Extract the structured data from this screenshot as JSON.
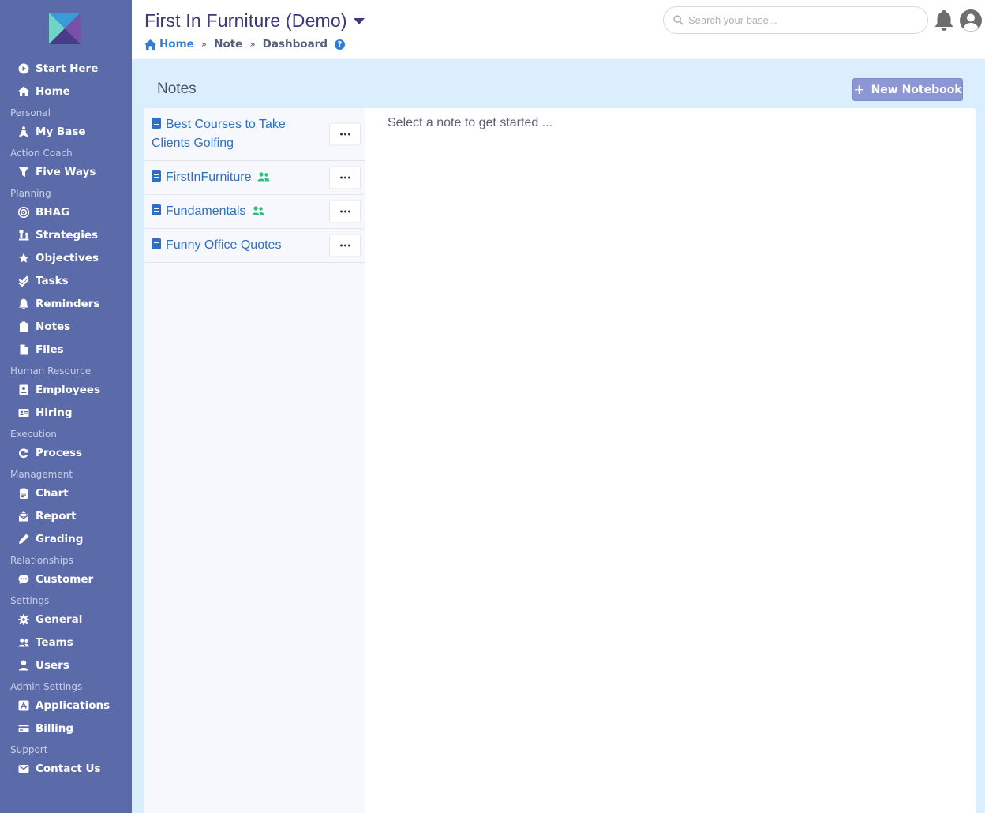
{
  "app": {
    "title": "First In Furniture (Demo)"
  },
  "breadcrumb": {
    "home": "Home",
    "items": [
      "Note",
      "Dashboard"
    ],
    "separator": "»",
    "help": "?"
  },
  "search": {
    "placeholder": "Search your base..."
  },
  "sidebar": {
    "items": [
      {
        "type": "item",
        "label": "Start Here",
        "icon": "play-circle-icon"
      },
      {
        "type": "item",
        "label": "Home",
        "icon": "home-icon"
      },
      {
        "type": "section",
        "label": "Personal"
      },
      {
        "type": "item",
        "label": "My Base",
        "icon": "meditation-icon"
      },
      {
        "type": "section",
        "label": "Action Coach"
      },
      {
        "type": "item",
        "label": "Five Ways",
        "icon": "five-ways-icon"
      },
      {
        "type": "section",
        "label": "Planning"
      },
      {
        "type": "item",
        "label": "BHAG",
        "icon": "target-icon"
      },
      {
        "type": "item",
        "label": "Strategies",
        "icon": "chess-icon"
      },
      {
        "type": "item",
        "label": "Objectives",
        "icon": "star-icon"
      },
      {
        "type": "item",
        "label": "Tasks",
        "icon": "check-double-icon"
      },
      {
        "type": "item",
        "label": "Reminders",
        "icon": "bell-icon"
      },
      {
        "type": "item",
        "label": "Notes",
        "icon": "clipboard-icon"
      },
      {
        "type": "item",
        "label": "Files",
        "icon": "file-icon"
      },
      {
        "type": "section",
        "label": "Human Resource"
      },
      {
        "type": "item",
        "label": "Employees",
        "icon": "contact-book-icon"
      },
      {
        "type": "item",
        "label": "Hiring",
        "icon": "id-card-icon"
      },
      {
        "type": "section",
        "label": "Execution"
      },
      {
        "type": "item",
        "label": "Process",
        "icon": "redo-icon"
      },
      {
        "type": "section",
        "label": "Management"
      },
      {
        "type": "item",
        "label": "Chart",
        "icon": "clipboard-list-icon"
      },
      {
        "type": "item",
        "label": "Report",
        "icon": "envelope-open-icon"
      },
      {
        "type": "item",
        "label": "Grading",
        "icon": "pen-icon"
      },
      {
        "type": "section",
        "label": "Relationships"
      },
      {
        "type": "item",
        "label": "Customer",
        "icon": "comment-dots-icon"
      },
      {
        "type": "section",
        "label": "Settings"
      },
      {
        "type": "item",
        "label": "General",
        "icon": "cog-icon"
      },
      {
        "type": "item",
        "label": "Teams",
        "icon": "users-icon"
      },
      {
        "type": "item",
        "label": "Users",
        "icon": "user-icon"
      },
      {
        "type": "section",
        "label": "Admin Settings"
      },
      {
        "type": "item",
        "label": "Applications",
        "icon": "app-store-icon"
      },
      {
        "type": "item",
        "label": "Billing",
        "icon": "credit-card-icon"
      },
      {
        "type": "section",
        "label": "Support"
      },
      {
        "type": "item",
        "label": "Contact Us",
        "icon": "envelope-icon"
      }
    ]
  },
  "notes": {
    "title": "Notes",
    "new_notebook": "New Notebook",
    "placeholder": "Select a note to get started ...",
    "notebooks": [
      {
        "label": "Best Courses to Take Clients Golfing",
        "shared": false
      },
      {
        "label": "FirstInFurniture",
        "shared": true
      },
      {
        "label": "Fundamentals",
        "shared": true
      },
      {
        "label": "Funny Office Quotes",
        "shared": false
      }
    ]
  },
  "colors": {
    "sidebar": "#5b6aa8",
    "accent": "#2f6fc0",
    "shared": "#2fbf7a",
    "button": "#8d97d6"
  }
}
